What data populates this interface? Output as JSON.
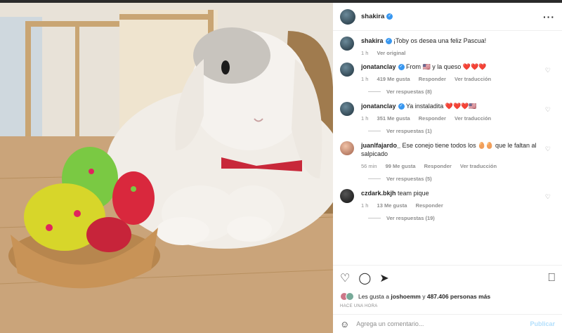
{
  "post": {
    "username": "shakira",
    "caption": "¡Toby os desea una feliz Pascua!",
    "time": "1 h",
    "see_original": "Ver original"
  },
  "comments": [
    {
      "user": "jonatanclay",
      "verified": true,
      "text": "From 🇺🇸 y la queso ❤️❤️❤️",
      "time": "1 h",
      "likes": "419 Me gusta",
      "reply": "Responder",
      "translate": "Ver traducción",
      "replies": "Ver respuestas (8)"
    },
    {
      "user": "jonatanclay",
      "verified": true,
      "text": "Ya instaladita ❤️❤️❤️🇺🇸",
      "time": "1 h",
      "likes": "351 Me gusta",
      "reply": "Responder",
      "translate": "Ver traducción",
      "replies": "Ver respuestas (1)"
    },
    {
      "user": "juanlfajardo_",
      "verified": false,
      "text": "Ese conejo tiene todos los 🥚🥚 que le faltan al salpicado",
      "time": "56 min",
      "likes": "99 Me gusta",
      "reply": "Responder",
      "translate": "Ver traducción",
      "replies": "Ver respuestas (5)"
    },
    {
      "user": "czdark.bkjh",
      "verified": false,
      "text": "team pique",
      "time": "1 h",
      "likes": "13 Me gusta",
      "reply": "Responder",
      "translate": "",
      "replies": "Ver respuestas (19)"
    }
  ],
  "likes_line": {
    "prefix": "Les gusta a",
    "user": "joshoemm",
    "mid": "y",
    "count": "487.406 personas más"
  },
  "date": "HACE UNA HORA",
  "comment_box": {
    "placeholder": "Agrega un comentario...",
    "post_label": "Publicar"
  },
  "icons": {
    "more": "more-options-icon",
    "like": "heart-icon",
    "comment": "comment-icon",
    "share": "share-icon",
    "save": "bookmark-icon",
    "emoji": "emoji-icon"
  },
  "colors": {
    "verified": "#3897f0",
    "publish_disabled": "#b2dffc"
  }
}
